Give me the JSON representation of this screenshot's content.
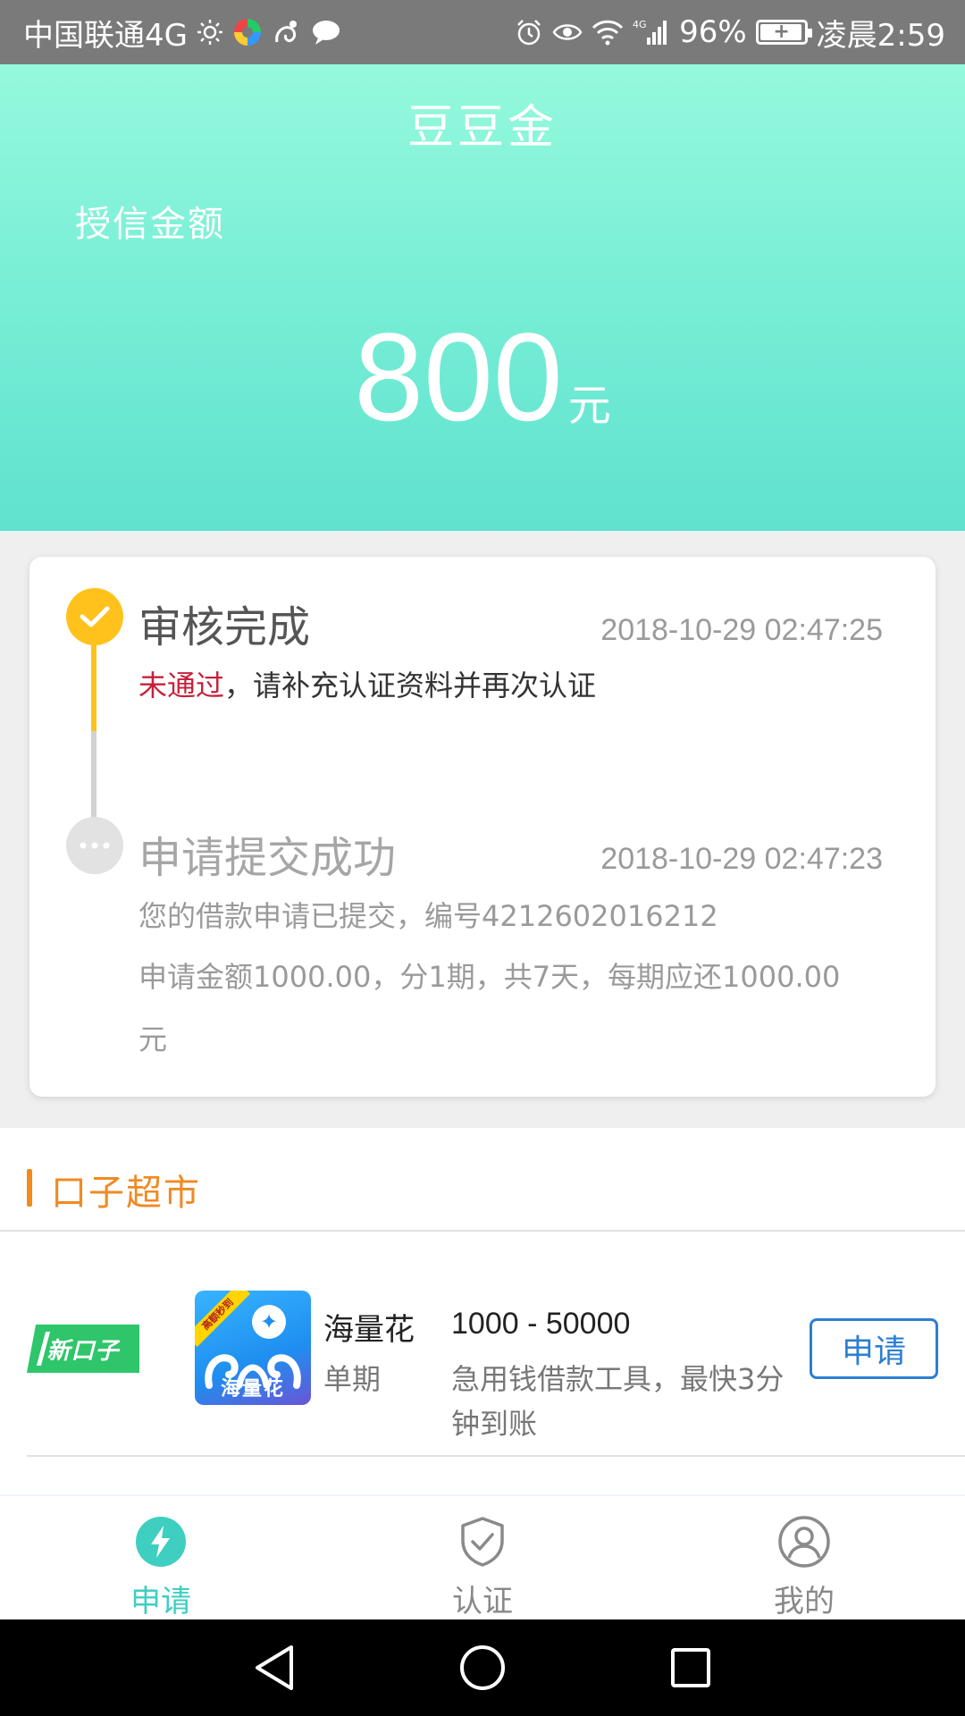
{
  "status_bar": {
    "carrier": "中国联通4G",
    "battery": "96%",
    "battery_level": 0.96,
    "time": "凌晨2:59",
    "network": "4G"
  },
  "header": {
    "title": "豆豆金",
    "credit_label": "授信金额",
    "amount": "800",
    "unit": "元"
  },
  "timeline": [
    {
      "title": "审核完成",
      "time": "2018-10-29 02:47:25",
      "status_word": "未通过",
      "message": "，请补充认证资料并再次认证"
    },
    {
      "title": "申请提交成功",
      "time": "2018-10-29 02:47:23",
      "line1": "您的借款申请已提交，编号4212602016212",
      "line2": "申请金额1000.00，分1期，共7天，每期应还1000.00",
      "line3": "元"
    }
  ],
  "market": {
    "title": "口子超市",
    "items": [
      {
        "badge": "新口子",
        "logo_text": "海量花",
        "logo_sash": "高额秒到",
        "name": "海量花",
        "term": "单期",
        "range": "1000 - 50000",
        "desc": "急用钱借款工具，最快3分钟到账",
        "apply": "申请"
      }
    ]
  },
  "bottom_nav": [
    {
      "label": "申请",
      "icon": "lightning-icon",
      "active": true
    },
    {
      "label": "认证",
      "icon": "shield-check-icon",
      "active": false
    },
    {
      "label": "我的",
      "icon": "user-icon",
      "active": false
    }
  ],
  "colors": {
    "header_top": "#95f9dd",
    "header_bottom": "#5fe2cf",
    "accent_teal": "#3ecfc0",
    "timeline_yellow": "#ffc21c",
    "fail_red": "#c8203a",
    "market_orange": "#f08a24",
    "button_blue": "#2c7fd0",
    "badge_green": "#2fc56a"
  }
}
